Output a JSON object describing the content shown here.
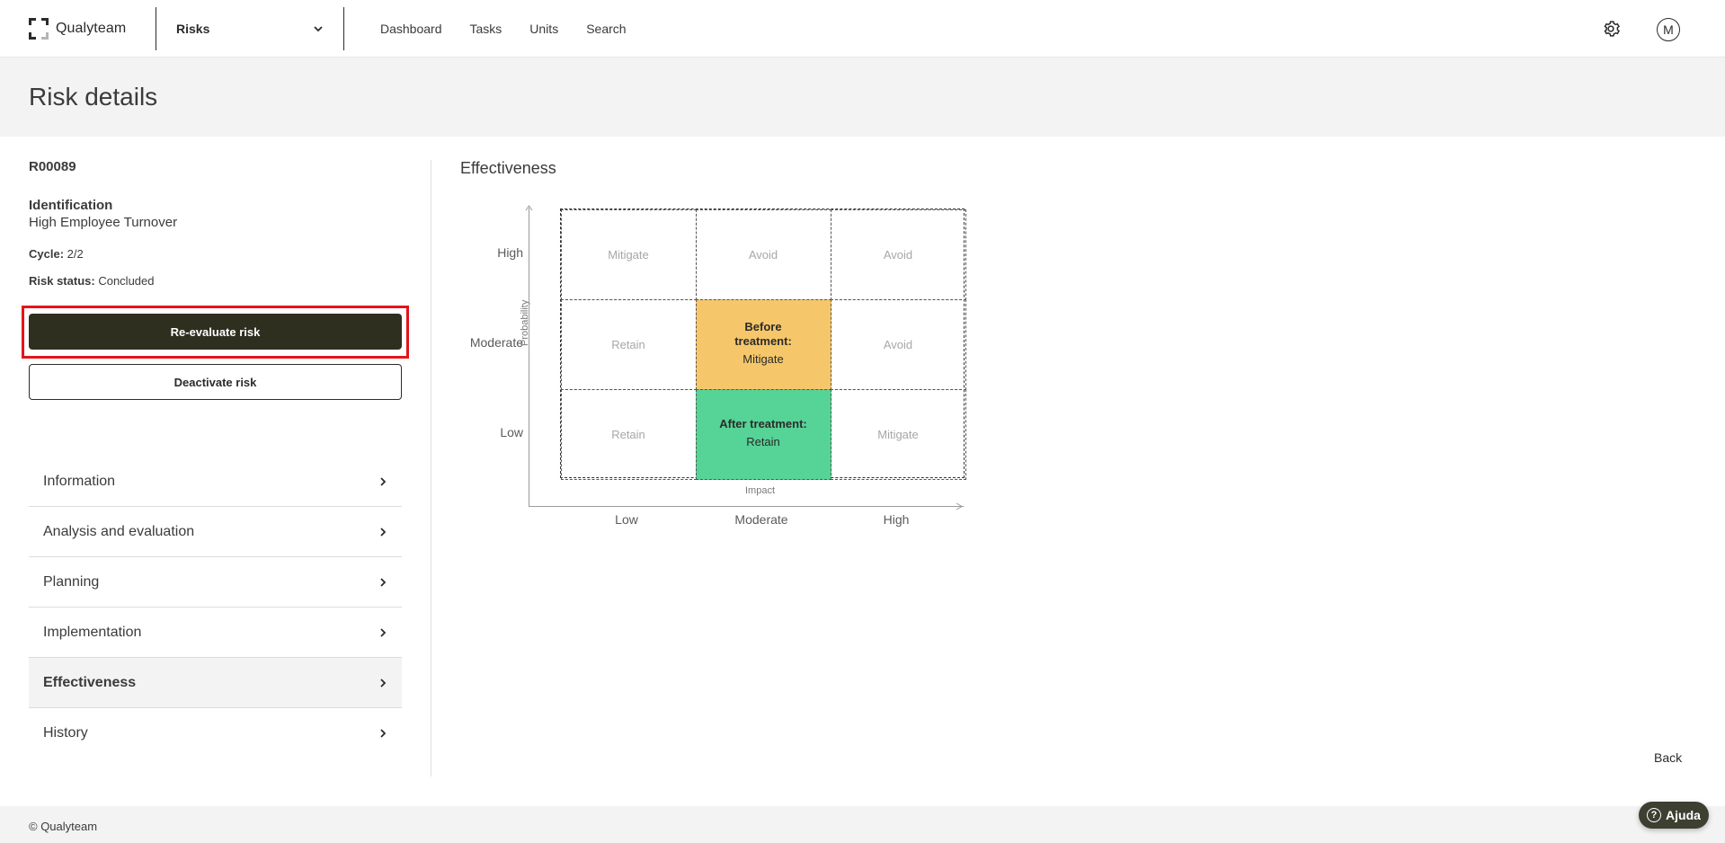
{
  "header": {
    "logo_text": "Qualyteam",
    "module": "Risks",
    "nav": [
      "Dashboard",
      "Tasks",
      "Units",
      "Search"
    ],
    "avatar_initial": "M"
  },
  "page": {
    "title": "Risk details"
  },
  "risk": {
    "code": "R00089",
    "identification_label": "Identification",
    "identification_value": "High Employee Turnover",
    "cycle_label": "Cycle:",
    "cycle_value": "2/2",
    "status_label": "Risk status:",
    "status_value": "Concluded"
  },
  "actions": {
    "reevaluate": "Re-evaluate risk",
    "deactivate": "Deactivate risk"
  },
  "menu": {
    "items": [
      {
        "label": "Information"
      },
      {
        "label": "Analysis and evaluation"
      },
      {
        "label": "Planning"
      },
      {
        "label": "Implementation"
      },
      {
        "label": "Effectiveness",
        "active": true
      },
      {
        "label": "History"
      }
    ]
  },
  "matrix": {
    "section_title": "Effectiveness",
    "y_axis_label": "Probability",
    "x_axis_label": "Impact",
    "y_levels": [
      "High",
      "Moderate",
      "Low"
    ],
    "x_levels": [
      "Low",
      "Moderate",
      "High"
    ],
    "cells": [
      [
        "Mitigate",
        "Avoid",
        "Avoid"
      ],
      [
        "Retain",
        "",
        "Avoid"
      ],
      [
        "Retain",
        "",
        "Mitigate"
      ]
    ],
    "before": {
      "title": "Before treatment:",
      "value": "Mitigate"
    },
    "after": {
      "title": "After treatment:",
      "value": "Retain"
    },
    "colors": {
      "before": "#f6c76a",
      "after": "#56d396"
    }
  },
  "back_label": "Back",
  "footer": {
    "copyright": "© Qualyteam",
    "help": "Ajuda"
  },
  "theme": {
    "primary": "#2f2f20",
    "highlight": "#e3141b"
  }
}
